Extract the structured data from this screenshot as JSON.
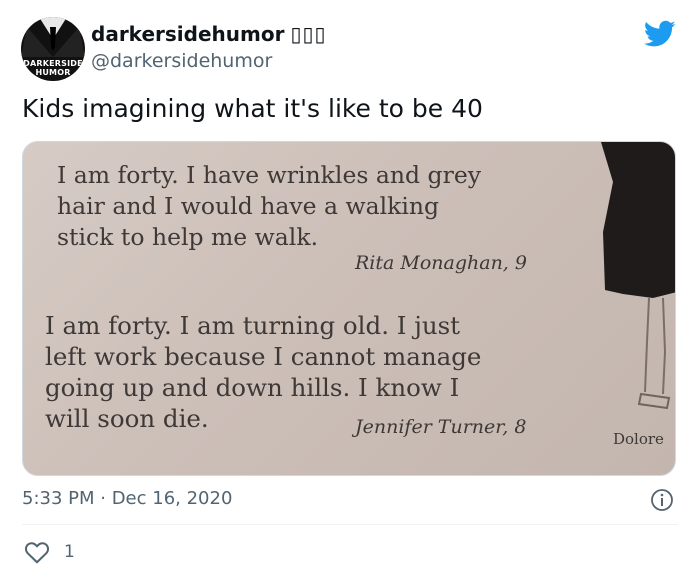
{
  "tweet": {
    "display_name": "darkersidehumor",
    "name_emoji": "▯▯▯",
    "handle": "@darkersidehumor",
    "avatar_text_line1": "DARKERSIDE",
    "avatar_text_line2": "HUMOR",
    "text": "Kids imagining what it's like to be 40",
    "timestamp": "5:33 PM · Dec 16, 2020",
    "like_count": "1",
    "brand_icon": "twitter-bird-icon",
    "accent_color": "#1d9bf0"
  },
  "photo": {
    "poem1_lines": [
      "I am forty. I have wrinkles and grey",
      "hair and I would have a walking",
      "stick to help me walk."
    ],
    "author1": "Rita Monaghan, 9",
    "poem2_lines": [
      "I am forty. I am turning old. I just",
      "left work because I cannot manage",
      "going up and down hills. I know I",
      "will soon die."
    ],
    "author2": "Jennifer Turner, 8",
    "author3": "Dolore"
  }
}
